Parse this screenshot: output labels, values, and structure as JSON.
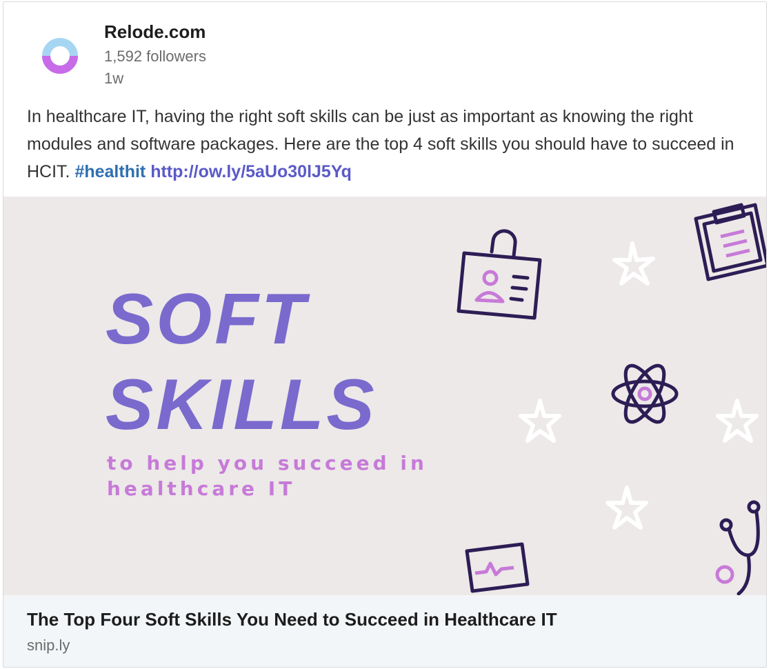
{
  "post": {
    "author": {
      "name": "Relode.com",
      "followers": "1,592 followers",
      "time": "1w",
      "logo_icon": "ring-logo-icon",
      "logo_colors": [
        "#a7d6f2",
        "#c86be8"
      ]
    },
    "text_before": "In healthcare IT, having the right soft skills can be just as important as knowing the right modules and software packages. Here are the top 4 soft skills you should have to succeed in HCIT. ",
    "hashtag": "#healthit",
    "link": "http://ow.ly/5aUo30lJ5Yq"
  },
  "banner": {
    "title_line1": "SOFT",
    "title_line2": "SKILLS",
    "subtitle_line1": "to help you succeed in",
    "subtitle_line2": "healthcare IT",
    "colors": {
      "background": "#ece9e8",
      "title": "#7a6acd",
      "subtitle": "#c77ad8",
      "icon_dark": "#2d1d55",
      "icon_accent": "#c77ad8"
    },
    "icons": [
      "id-badge-icon",
      "clipboard-icon",
      "star-icon",
      "atom-icon",
      "stethoscope-icon",
      "monitor-icon"
    ]
  },
  "link_preview": {
    "title": "The Top Four Soft Skills You Need to Succeed in Healthcare IT",
    "domain": "snip.ly"
  }
}
